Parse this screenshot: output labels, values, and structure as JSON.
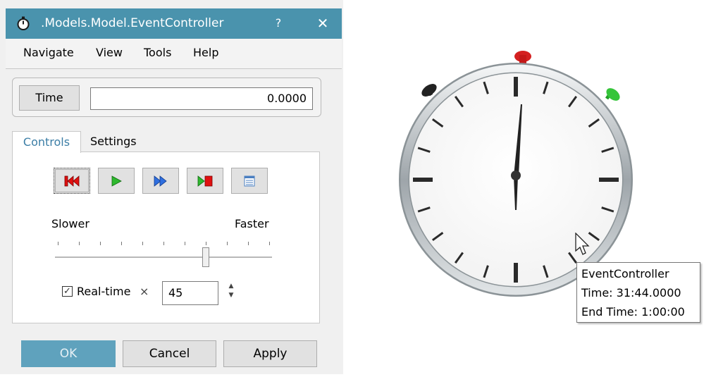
{
  "window": {
    "title": ".Models.Model.EventController",
    "help_glyph": "?",
    "close_glyph": "✕",
    "title_bar_color": "#4a93ad"
  },
  "menu": [
    "Navigate",
    "View",
    "Tools",
    "Help"
  ],
  "time": {
    "button_label": "Time",
    "value": "0.0000"
  },
  "tabs": [
    {
      "label": "Controls",
      "active": true
    },
    {
      "label": "Settings",
      "active": false
    }
  ],
  "controls": {
    "playback_buttons": [
      {
        "name": "reset",
        "icon": "rewind-to-start-icon"
      },
      {
        "name": "play",
        "icon": "play-icon"
      },
      {
        "name": "fast-forward",
        "icon": "fast-forward-icon"
      },
      {
        "name": "run-to-end",
        "icon": "play-stop-icon"
      },
      {
        "name": "event-list",
        "icon": "list-icon"
      }
    ],
    "speed": {
      "slower_label": "Slower",
      "faster_label": "Faster",
      "tick_count": 11,
      "position_index": 7
    },
    "realtime": {
      "checked": true,
      "label": "Real-time",
      "multiplier_symbol": "×",
      "factor": "45"
    }
  },
  "footer": {
    "ok_label": "OK",
    "cancel_label": "Cancel",
    "apply_label": "Apply"
  },
  "viewport": {
    "stopwatch": {
      "pins": [
        {
          "color": "#222222"
        },
        {
          "color": "#d42020"
        },
        {
          "color": "#35c53a"
        }
      ]
    },
    "tooltip": {
      "name": "EventController",
      "time": "Time: 31:44.0000",
      "end_time": "End Time: 1:00:00"
    }
  }
}
